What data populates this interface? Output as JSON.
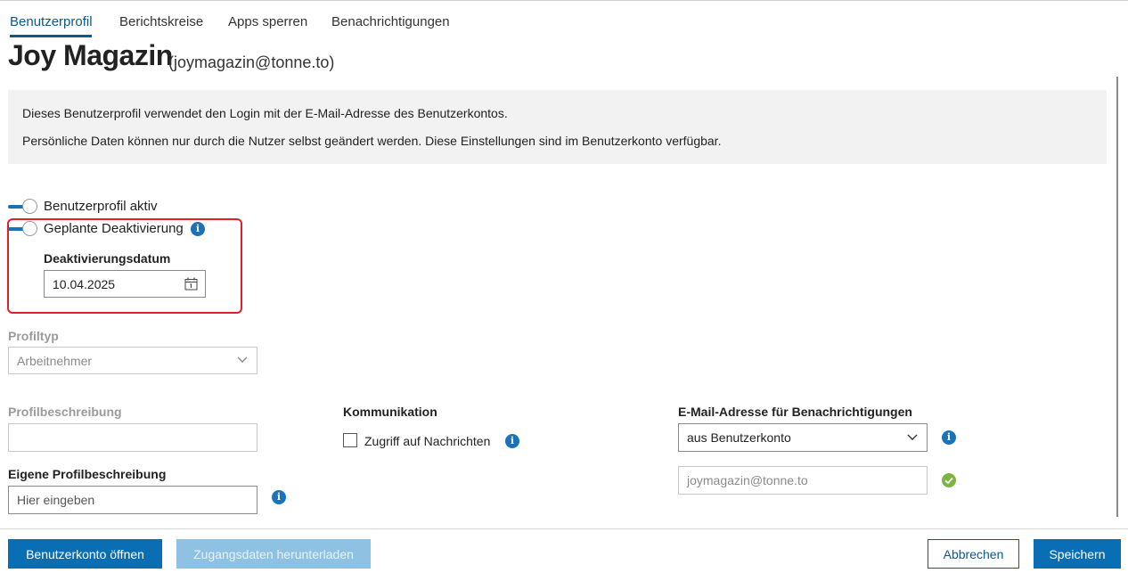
{
  "tabs": [
    {
      "label": "Benutzerprofil",
      "active": true
    },
    {
      "label": "Berichtskreise",
      "active": false
    },
    {
      "label": "Apps sperren",
      "active": false
    },
    {
      "label": "Benachrichtigungen",
      "active": false
    }
  ],
  "header": {
    "title": "Joy Magazin",
    "email": "(joymagazin@tonne.to)"
  },
  "info": {
    "line1": "Dieses Benutzerprofil verwendet den Login mit der E-Mail-Adresse des Benutzerkontos.",
    "line2": "Persönliche Daten können nur durch die Nutzer selbst geändert werden. Diese Einstellungen sind im Benutzerkonto verfügbar."
  },
  "toggles": {
    "active_label": "Benutzerprofil aktiv",
    "deactivation_label": "Geplante Deaktivierung"
  },
  "deactivation": {
    "label": "Deaktivierungsdatum",
    "value": "10.04.2025"
  },
  "profile_type": {
    "label": "Profiltyp",
    "value": "Arbeitnehmer"
  },
  "profile_description": {
    "label": "Profilbeschreibung",
    "value": ""
  },
  "own_description": {
    "label": "Eigene Profilbeschreibung",
    "placeholder": "Hier eingeben"
  },
  "communication": {
    "label": "Kommunikation",
    "checkbox_label": "Zugriff auf Nachrichten",
    "checked": false
  },
  "notification_email": {
    "label": "E-Mail-Adresse für Benachrichtigungen",
    "source": "aus Benutzerkonto",
    "address": "joymagazin@tonne.to"
  },
  "footer": {
    "open_account": "Benutzerkonto öffnen",
    "download": "Zugangsdaten herunterladen",
    "cancel": "Abbrechen",
    "save": "Speichern"
  },
  "icons": {
    "info": "info-icon",
    "calendar": "calendar-icon",
    "chevron": "chevron-down-icon",
    "check": "check-circle-icon"
  },
  "colors": {
    "accent": "#0a6eb4",
    "highlight": "#e0202a",
    "success": "#7cb342"
  }
}
